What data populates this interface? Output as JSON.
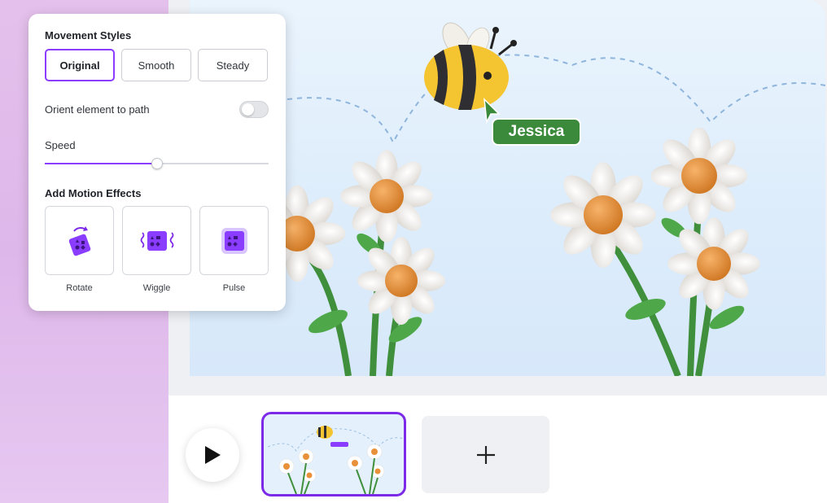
{
  "panel": {
    "movement_title": "Movement Styles",
    "styles": [
      {
        "label": "Original",
        "selected": true
      },
      {
        "label": "Smooth",
        "selected": false
      },
      {
        "label": "Steady",
        "selected": false
      }
    ],
    "orient_label": "Orient element to path",
    "orient_enabled": false,
    "speed_label": "Speed",
    "speed_value": 0.5,
    "effects_title": "Add Motion Effects",
    "effects": [
      {
        "label": "Rotate",
        "icon": "rotate-icon"
      },
      {
        "label": "Wiggle",
        "icon": "wiggle-icon"
      },
      {
        "label": "Pulse",
        "icon": "pulse-icon"
      }
    ]
  },
  "canvas": {
    "collaborator_name": "Jessica",
    "collaborator_color": "#3b8a3c"
  },
  "timeline": {
    "play_icon": "play-icon",
    "add_icon": "plus-icon",
    "thumbnail_tag": "Jessica"
  },
  "colors": {
    "accent": "#8b3dff",
    "bee_yellow": "#f5c531",
    "flower_center": "#e8913a",
    "stem": "#3f8f3c"
  }
}
